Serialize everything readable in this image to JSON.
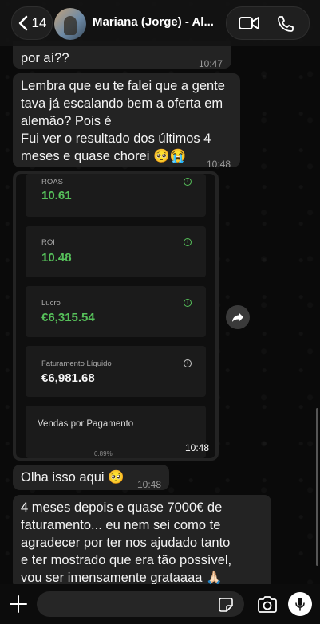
{
  "header": {
    "back_count": "14",
    "contact_name": "Mariana (Jorge) - Al..."
  },
  "messages": [
    {
      "text": "por aí??",
      "time": "10:47"
    },
    {
      "text": "Lembra que eu te falei que a gente\ntava já escalando bem a oferta em\nalemão? Pois é\nFui ver o resultado dos últimos 4\nmeses e quase chorei 🥺😭",
      "time": "10:48"
    },
    {
      "text": "Olha isso aqui 🥺",
      "time": "10:48"
    },
    {
      "text": "4 meses depois e quase 7000€ de\nfaturamento... eu nem sei como te\nagradecer por ter nos ajudado tanto\ne ter mostrado que era tão possível,\nvou ser imensamente grataaaa 🙏🏻"
    }
  ],
  "image_message": {
    "time": "10:48",
    "cards": [
      {
        "label": "ROAS",
        "value": "10.61"
      },
      {
        "label": "ROI",
        "value": "10.48"
      },
      {
        "label": "Lucro",
        "value": "€6,315.54"
      },
      {
        "label": "Faturamento Líquido",
        "value": "€6,981.68"
      }
    ],
    "vendas_label": "Vendas por Pagamento",
    "vendas_small": "0.89%"
  },
  "input": {
    "placeholder": ""
  },
  "colors": {
    "accent_green": "#56c05a",
    "bubble": "#232323",
    "background": "#0b0b0b"
  },
  "icons": [
    "chevron-left-icon",
    "video-call-icon",
    "phone-icon",
    "share-forward-icon",
    "plus-icon",
    "sticker-icon",
    "camera-icon",
    "microphone-icon"
  ]
}
